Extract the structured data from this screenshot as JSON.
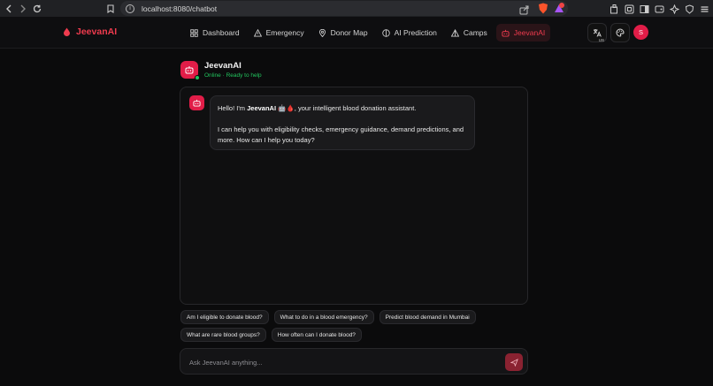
{
  "browser": {
    "url": "localhost:8080/chatbot"
  },
  "header": {
    "brand": "JeevanAI",
    "nav": [
      {
        "label": "Dashboard",
        "icon": "grid-icon"
      },
      {
        "label": "Emergency",
        "icon": "warning-icon"
      },
      {
        "label": "Donor Map",
        "icon": "map-pin-icon"
      },
      {
        "label": "AI Prediction",
        "icon": "brain-icon"
      },
      {
        "label": "Camps",
        "icon": "tent-icon"
      },
      {
        "label": "JeevanAI",
        "icon": "bot-icon",
        "active": true
      }
    ],
    "translate_sub": "US",
    "avatar_initial": "S"
  },
  "chat": {
    "title": "JeevanAI",
    "status": "Online · Ready to help",
    "message": {
      "greeting_pre": "Hello! I'm ",
      "greeting_name": "JeevanAI",
      "greeting_post": " 🤖🩸, your intelligent blood donation assistant.",
      "body": "I can help you with eligibility checks, emergency guidance, demand predictions, and more. How can I help you today?"
    },
    "suggestions_row1": [
      "Am I eligible to donate blood?",
      "What to do in a blood emergency?",
      "Predict blood demand in Mumbai"
    ],
    "suggestions_row2": [
      "What are rare blood groups?",
      "How often can I donate blood?"
    ],
    "input_placeholder": "Ask JeevanAI anything..."
  },
  "colors": {
    "accent": "#e11d48",
    "brand_text": "#ef3b4e",
    "online": "#22c55e",
    "background": "#0b0b0c"
  }
}
